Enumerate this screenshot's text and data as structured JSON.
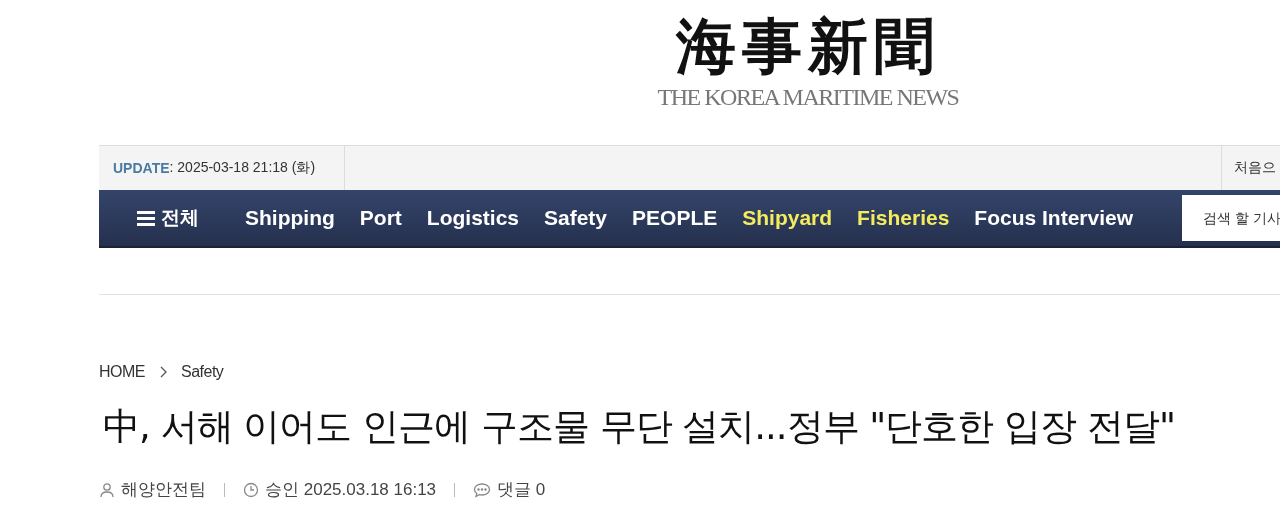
{
  "logo": {
    "title": "海事新聞",
    "subtitle": "THE KOREA MARITIME NEWS"
  },
  "update_bar": {
    "label": "UPDATE",
    "value": " : 2025-03-18 21:18 (화)",
    "right_link": "처음으"
  },
  "nav": {
    "menu_label": "전체",
    "items": [
      {
        "label": "Shipping",
        "color": "#ffffff"
      },
      {
        "label": "Port",
        "color": "#ffffff"
      },
      {
        "label": "Logistics",
        "color": "#ffffff"
      },
      {
        "label": "Safety",
        "color": "#ffffff"
      },
      {
        "label": "PEOPLE",
        "color": "#ffffff"
      },
      {
        "label": "Shipyard",
        "color": "#f3ec5e"
      },
      {
        "label": "Fisheries",
        "color": "#f3ec5e"
      },
      {
        "label": "Focus Interview",
        "color": "#ffffff"
      }
    ],
    "search": {
      "placeholder": "검색 할 기사"
    }
  },
  "breadcrumb": [
    "HOME",
    "Safety"
  ],
  "article": {
    "headline": "中, 서해 이어도 인근에 구조물 무단 설치...정부 \"단호한 입장 전달\"",
    "meta": [
      {
        "kind": "author",
        "text": "해양안전팀"
      },
      {
        "kind": "time",
        "text": "승인 2025.03.18 16:13"
      },
      {
        "kind": "comments",
        "text": "댓글 0"
      }
    ]
  }
}
